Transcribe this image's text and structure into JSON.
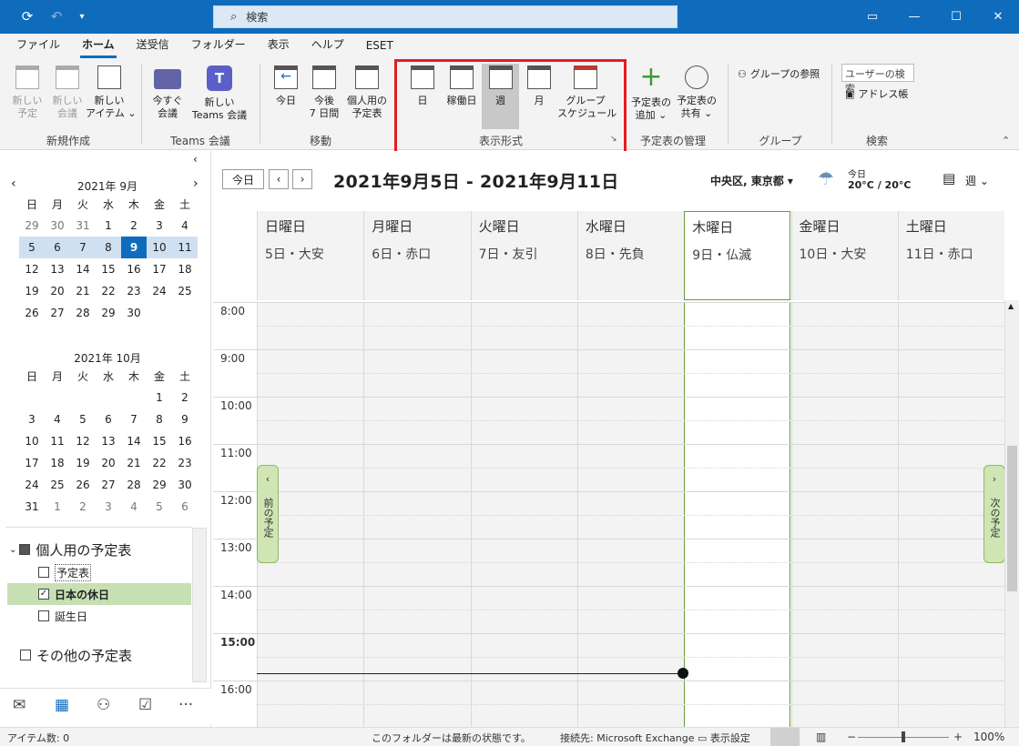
{
  "search": {
    "placeholder": "検索"
  },
  "menu": [
    "ファイル",
    "ホーム",
    "送受信",
    "フォルダー",
    "表示",
    "ヘルプ",
    "ESET"
  ],
  "ribbon": {
    "new_group": {
      "label": "新規作成",
      "buttons": [
        "新しい\n予定",
        "新しい\n会議",
        "新しい\nアイテム ⌄"
      ]
    },
    "teams_group": {
      "label": "Teams 会議",
      "buttons": [
        "今すぐ\n会議",
        "新しい\nTeams 会議"
      ]
    },
    "go_group": {
      "label": "移動",
      "buttons": [
        "今日",
        "今後\n7 日間",
        "個人用の\n予定表"
      ]
    },
    "view_group": {
      "label": "表示形式",
      "buttons": [
        "日",
        "稼働日",
        "週",
        "月",
        "グループ\nスケジュール"
      ]
    },
    "manage_group": {
      "label": "予定表の管理",
      "buttons": [
        "予定表の\n追加 ⌄",
        "予定表の\n共有 ⌄"
      ]
    },
    "groups_group": {
      "label": "グループ",
      "buttons": [
        "グループの参照"
      ]
    },
    "search_group": {
      "label": "検索",
      "buttons": [
        "ユーザーの検索",
        "アドレス帳"
      ]
    }
  },
  "minical1": {
    "title": "2021年 9月",
    "weekdays": [
      "日",
      "月",
      "火",
      "水",
      "木",
      "金",
      "土"
    ],
    "days": [
      "29",
      "30",
      "31",
      "1",
      "2",
      "3",
      "4",
      "5",
      "6",
      "7",
      "8",
      "9",
      "10",
      "11",
      "12",
      "13",
      "14",
      "15",
      "16",
      "17",
      "18",
      "19",
      "20",
      "21",
      "22",
      "23",
      "24",
      "25",
      "26",
      "27",
      "28",
      "29",
      "30"
    ]
  },
  "minical2": {
    "title": "2021年 10月",
    "weekdays": [
      "日",
      "月",
      "火",
      "水",
      "木",
      "金",
      "土"
    ],
    "days": [
      "1",
      "2",
      "3",
      "4",
      "5",
      "6",
      "7",
      "8",
      "9",
      "10",
      "11",
      "12",
      "13",
      "14",
      "15",
      "16",
      "17",
      "18",
      "19",
      "20",
      "21",
      "22",
      "23",
      "24",
      "25",
      "26",
      "27",
      "28",
      "29",
      "30",
      "31",
      "1",
      "2",
      "3",
      "4",
      "5",
      "6"
    ]
  },
  "folders": {
    "group1": "個人用の予定表",
    "items": [
      "予定表",
      "日本の休日",
      "誕生日"
    ],
    "group2": "その他の予定表"
  },
  "calendar": {
    "today_btn": "今日",
    "range": "2021年9月5日 - 2021年9月11日",
    "location": "中央区, 東京都 ▾",
    "weather_label": "今日",
    "weather_temp": "20°C / 20°C",
    "view_select": "週 ⌄",
    "days": [
      {
        "name": "日曜日",
        "date": "5日・大安"
      },
      {
        "name": "月曜日",
        "date": "6日・赤口"
      },
      {
        "name": "火曜日",
        "date": "7日・友引"
      },
      {
        "name": "水曜日",
        "date": "8日・先負"
      },
      {
        "name": "木曜日",
        "date": "9日・仏滅"
      },
      {
        "name": "金曜日",
        "date": "10日・大安"
      },
      {
        "name": "土曜日",
        "date": "11日・赤口"
      }
    ],
    "hours": [
      "8:00",
      "9:00",
      "10:00",
      "11:00",
      "12:00",
      "13:00",
      "14:00",
      "15:00",
      "16:00"
    ],
    "prev_appt": "前の予定",
    "next_appt": "次の予定"
  },
  "status": {
    "items": "アイテム数: 0",
    "folder_state": "このフォルダーは最新の状態です。",
    "connection": "接続先: Microsoft Exchange",
    "display_settings": "表示設定",
    "zoom": "100%"
  }
}
